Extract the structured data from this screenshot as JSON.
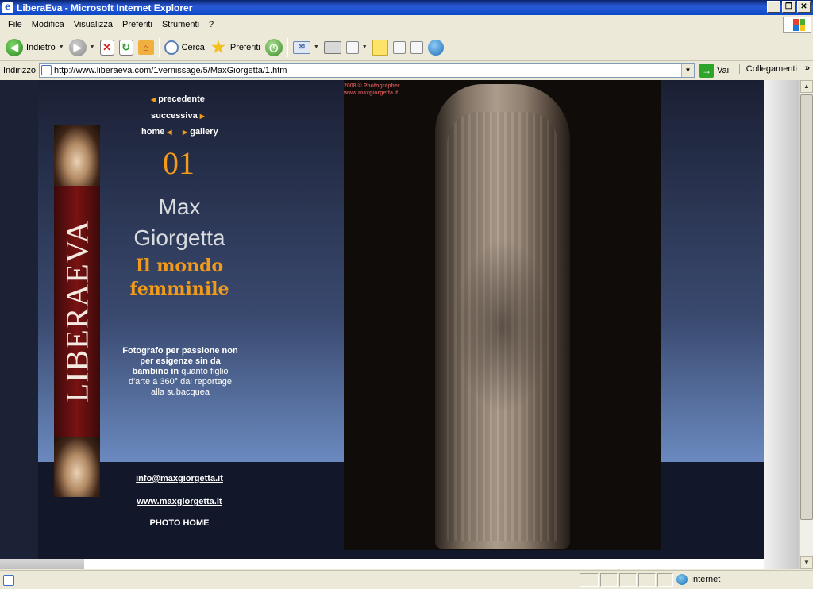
{
  "window": {
    "title": "LiberaEva - Microsoft Internet Explorer",
    "buttons": [
      "_",
      "❐",
      "✕"
    ]
  },
  "menu": [
    "File",
    "Modifica",
    "Visualizza",
    "Preferiti",
    "Strumenti",
    "?"
  ],
  "toolbar": {
    "back_label": "Indietro",
    "search_label": "Cerca",
    "favorites_label": "Preferiti"
  },
  "address": {
    "label": "Indirizzo",
    "url": "http://www.liberaeva.com/1vernissage/5/MaxGiorgetta/1.htm",
    "go_label": "Vai",
    "links_label": "Collegamenti",
    "links_chevron": "»"
  },
  "page": {
    "banner_text": "LIBERAEVA",
    "nav": {
      "prev": "precedente",
      "next": "successiva",
      "home": "home",
      "gallery": "gallery"
    },
    "number": "01",
    "name_first": "Max",
    "name_last": "Giorgetta",
    "subtitle_1": "Il mondo",
    "subtitle_2": "femminile",
    "bio_bold": "Fotografo per passione non per esigenze sin da bambino in",
    "bio_rest": " quanto figlio d'arte a 360° dal reportage alla subacquea",
    "email": "info@maxgiorgetta.it",
    "website": "www.maxgiorgetta.it",
    "photo_home": "PHOTO  HOME",
    "photo_credit_1": "2008 © Photographer",
    "photo_credit_2": "www.maxgiorgetta.it"
  },
  "status": {
    "zone": "Internet"
  },
  "colors": {
    "accent": "#f29a1a",
    "banner": "#7a1212",
    "page_bg_top": "#1a1f33",
    "page_bg_bottom": "#7391c8"
  }
}
